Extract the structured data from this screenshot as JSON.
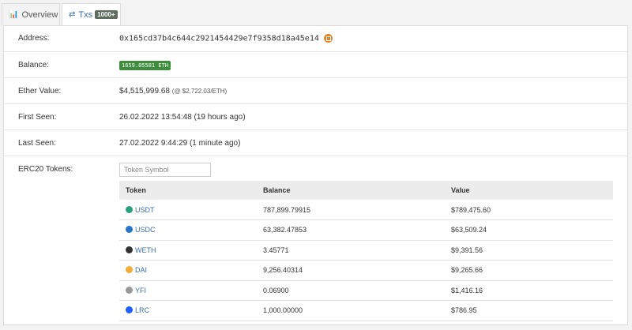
{
  "tabs": {
    "overview": {
      "icon": "bar-chart-icon",
      "label": "Overview"
    },
    "txs": {
      "icon": "transfer-arrows-icon",
      "label": "Txs",
      "badge": "1000+"
    }
  },
  "details": {
    "address": {
      "label": "Address:",
      "value": "0x165cd37b4c644c2921454429e7f9358d18a45e14"
    },
    "balance": {
      "label": "Balance:",
      "value": "1659.05581 ETH"
    },
    "ether_value": {
      "label": "Ether Value:",
      "value": "$4,515,999.68",
      "rate": "(@ $2,722.03/ETH)"
    },
    "first_seen": {
      "label": "First Seen:",
      "value": "26.02.2022 13:54:48 (19 hours ago)"
    },
    "last_seen": {
      "label": "Last Seen:",
      "value": "27.02.2022 9:44:29 (1 minute ago)"
    },
    "erc20": {
      "label": "ERC20 Tokens:",
      "search_placeholder": "Token Symbol"
    }
  },
  "token_table": {
    "headers": [
      "Token",
      "Balance",
      "Value"
    ],
    "rows": [
      {
        "token": "USDT",
        "balance": "787,899.79915",
        "value": "$789,475.60",
        "icon_color": "#26a17b"
      },
      {
        "token": "USDC",
        "balance": "63,382.47853",
        "value": "$63,509.24",
        "icon_color": "#2775ca"
      },
      {
        "token": "WETH",
        "balance": "3.45771",
        "value": "$9,391.56",
        "icon_color": "#333333"
      },
      {
        "token": "DAI",
        "balance": "9,256.40314",
        "value": "$9,265.66",
        "icon_color": "#f5ac37"
      },
      {
        "token": "YFI",
        "balance": "0.06900",
        "value": "$1,416.16",
        "icon_color": "#999999"
      },
      {
        "token": "LRC",
        "balance": "1,000.00000",
        "value": "$786.95",
        "icon_color": "#1c60ff"
      }
    ]
  },
  "colors": {
    "link": "#3a6ea5",
    "eth_pill": "#3c8d3c",
    "copy_icon": "#e8862a"
  }
}
